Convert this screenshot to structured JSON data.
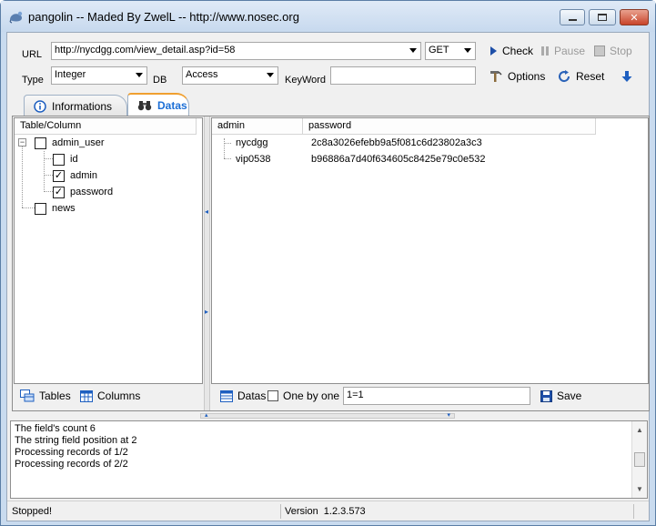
{
  "window": {
    "title": "pangolin -- Maded By ZwelL -- http://www.nosec.org",
    "controls": {
      "minimize_icon": "minimize-icon",
      "maximize_icon": "maximize-icon",
      "close_icon": "close-icon"
    }
  },
  "toolbar": {
    "url_label": "URL",
    "url_value": "http://nycdgg.com/view_detail.asp?id=58",
    "method_value": "GET",
    "check_label": "Check",
    "pause_label": "Pause",
    "stop_label": "Stop",
    "type_label": "Type",
    "type_value": "Integer",
    "db_label": "DB",
    "db_value": "Access",
    "keyword_label": "KeyWord",
    "keyword_value": "",
    "options_label": "Options",
    "reset_label": "Reset"
  },
  "tabs": [
    {
      "label": "Informations",
      "icon": "info-icon",
      "active": false
    },
    {
      "label": "Datas",
      "icon": "binoculars-icon",
      "active": true
    }
  ],
  "tree": {
    "header": "Table/Column",
    "nodes": [
      {
        "label": "admin_user",
        "checked": false,
        "expanded": true
      },
      {
        "label": "id",
        "checked": false
      },
      {
        "label": "admin",
        "checked": true
      },
      {
        "label": "password",
        "checked": true
      },
      {
        "label": "news",
        "checked": false
      }
    ],
    "footer": {
      "tables_label": "Tables",
      "columns_label": "Columns"
    }
  },
  "grid": {
    "columns": [
      "admin",
      "password"
    ],
    "rows": [
      [
        "nycdgg",
        "2c8a3026efebb9a5f081c6d23802a3c3"
      ],
      [
        "vip0538",
        "b96886a7d40f634605c8425e79c0e532"
      ]
    ],
    "footer": {
      "datas_label": "Datas",
      "one_by_one_label": "One by one",
      "one_by_one_checked": false,
      "condition_value": "1=1",
      "save_label": "Save"
    }
  },
  "log": {
    "lines": [
      "The field's count 6",
      "The string field position at 2",
      "Processing records of 1/2",
      "Processing records of 2/2"
    ]
  },
  "status": {
    "state": "Stopped!",
    "version": "Version  1.2.3.573"
  }
}
